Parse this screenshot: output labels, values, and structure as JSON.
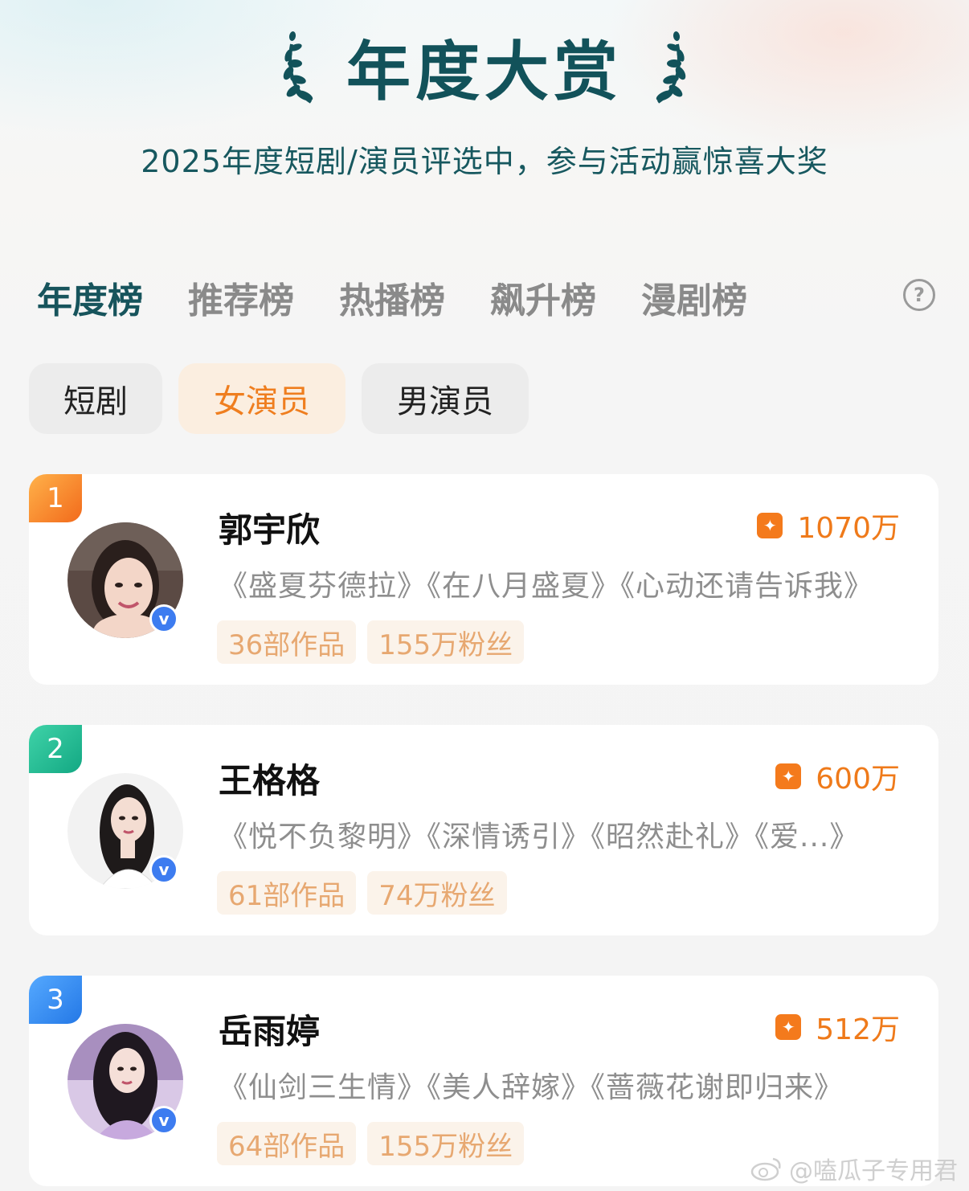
{
  "header": {
    "title": "年度大赏",
    "subtitle": "2025年度短剧/演员评选中，参与活动赢惊喜大奖"
  },
  "tabs": [
    {
      "label": "年度榜",
      "active": true
    },
    {
      "label": "推荐榜",
      "active": false
    },
    {
      "label": "热播榜",
      "active": false
    },
    {
      "label": "飙升榜",
      "active": false
    },
    {
      "label": "漫剧榜",
      "active": false
    }
  ],
  "help_icon": "?",
  "filters": [
    {
      "label": "短剧",
      "active": false
    },
    {
      "label": "女演员",
      "active": true
    },
    {
      "label": "男演员",
      "active": false
    }
  ],
  "ranking": [
    {
      "rank": "1",
      "name": "郭宇欣",
      "score": "1070万",
      "works": "《盛夏芬德拉》《在八月盛夏》《心动还请告诉我》",
      "works_count": "36部作品",
      "fans": "155万粉丝",
      "verified_label": "v"
    },
    {
      "rank": "2",
      "name": "王格格",
      "score": "600万",
      "works": "《悦不负黎明》《深情诱引》《昭然赴礼》《爱...》",
      "works_count": "61部作品",
      "fans": "74万粉丝",
      "verified_label": "v"
    },
    {
      "rank": "3",
      "name": "岳雨婷",
      "score": "512万",
      "works": "《仙剑三生情》《美人辞嫁》《蔷薇花谢即归来》",
      "works_count": "64部作品",
      "fans": "155万粉丝",
      "verified_label": "v"
    }
  ],
  "score_icon": "✦",
  "watermark": "@嗑瓜子专用君",
  "colors": {
    "accent_teal": "#12525a",
    "accent_orange": "#ef7a1a",
    "rank1": "#f26a1b",
    "rank2": "#13a883",
    "rank3": "#2478e6",
    "verified": "#3d7cf0"
  }
}
